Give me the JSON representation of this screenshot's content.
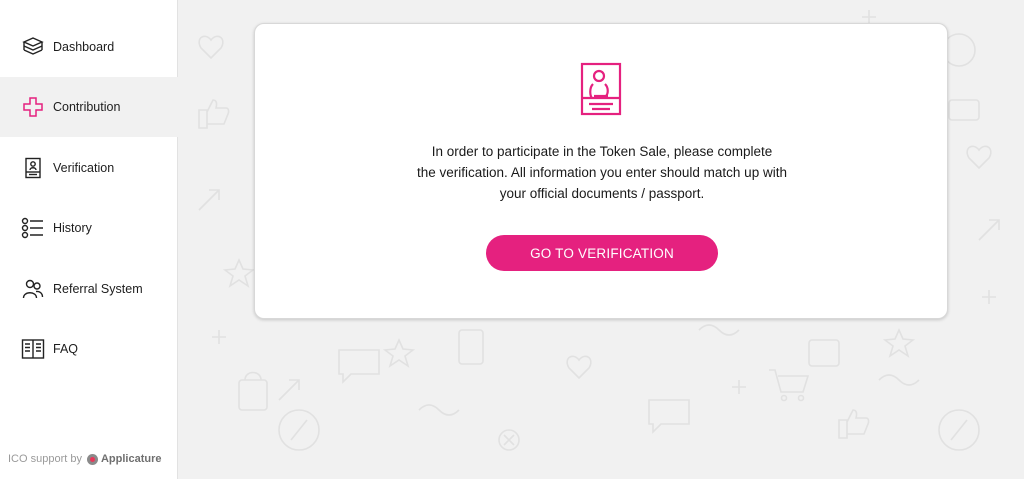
{
  "sidebar": {
    "items": [
      {
        "label": "Dashboard",
        "icon": "stack-icon"
      },
      {
        "label": "Contribution",
        "icon": "plus-cross-icon",
        "active": true
      },
      {
        "label": "Verification",
        "icon": "id-card-icon"
      },
      {
        "label": "History",
        "icon": "list-icon"
      },
      {
        "label": "Referral System",
        "icon": "users-icon"
      },
      {
        "label": "FAQ",
        "icon": "book-icon"
      }
    ],
    "footer": {
      "prefix": "ICO support by",
      "brand": "Applicature"
    }
  },
  "main": {
    "card": {
      "icon": "id-card-icon",
      "message_lines": [
        "In order to participate in the Token Sale, please complete",
        "the verification. All information you enter should match up with",
        "your official documents / passport."
      ],
      "button_label": "GO TO VERIFICATION"
    }
  },
  "colors": {
    "accent": "#e5217f",
    "sidebar_active_bg": "#f1f1f1",
    "page_bg": "#f1f1f1"
  }
}
